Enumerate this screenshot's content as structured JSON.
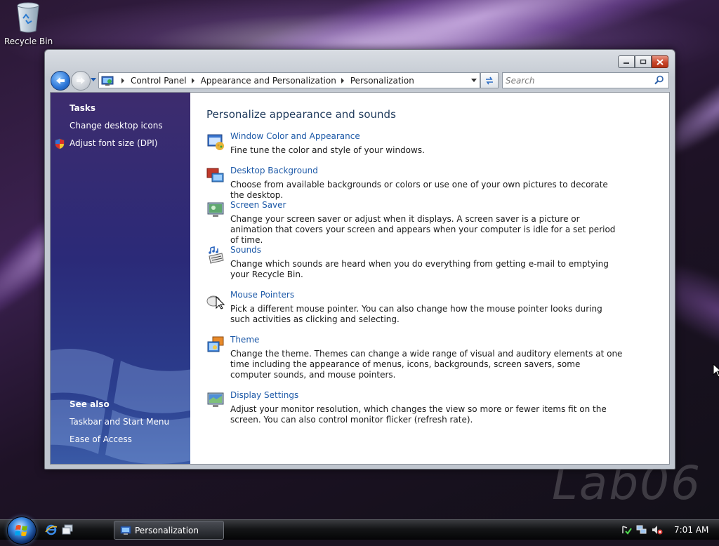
{
  "desktop": {
    "recycle_bin_label": "Recycle Bin",
    "watermark": "Lab06"
  },
  "window": {
    "address": {
      "crumbs": [
        "Control Panel",
        "Appearance and Personalization",
        "Personalization"
      ]
    },
    "search": {
      "placeholder": "Search"
    },
    "sidebar": {
      "tasks_heading": "Tasks",
      "tasks": [
        "Change desktop icons",
        "Adjust font size (DPI)"
      ],
      "see_also_heading": "See also",
      "see_also": [
        "Taskbar and Start Menu",
        "Ease of Access"
      ]
    },
    "main": {
      "title": "Personalize appearance and sounds",
      "items": [
        {
          "icon": "window-color-icon",
          "title": "Window Color and Appearance",
          "desc": "Fine tune the color and style of your windows."
        },
        {
          "icon": "desktop-background-icon",
          "title": "Desktop Background",
          "desc": "Choose from available backgrounds or colors or use one of your own pictures to decorate the desktop."
        },
        {
          "icon": "screen-saver-icon",
          "title": "Screen Saver",
          "desc": "Change your screen saver or adjust when it displays. A screen saver is a picture or animation that covers your screen and appears when your computer is idle for a set period of time."
        },
        {
          "icon": "sounds-icon",
          "title": "Sounds",
          "desc": "Change which sounds are heard when you do everything from getting e-mail to emptying your Recycle Bin."
        },
        {
          "icon": "mouse-pointers-icon",
          "title": "Mouse Pointers",
          "desc": "Pick a different mouse pointer. You can also change how the mouse pointer looks during such activities as clicking and selecting."
        },
        {
          "icon": "theme-icon",
          "title": "Theme",
          "desc": "Change the theme. Themes can change a wide range of visual and auditory elements at one time including the appearance of menus, icons, backgrounds, screen savers, some computer sounds, and mouse pointers."
        },
        {
          "icon": "display-settings-icon",
          "title": "Display Settings",
          "desc": "Adjust your monitor resolution, which changes the view so more or fewer items fit on the screen. You can also control monitor flicker (refresh rate)."
        }
      ]
    }
  },
  "taskbar": {
    "active_task": "Personalization",
    "clock": "7:01 AM"
  }
}
